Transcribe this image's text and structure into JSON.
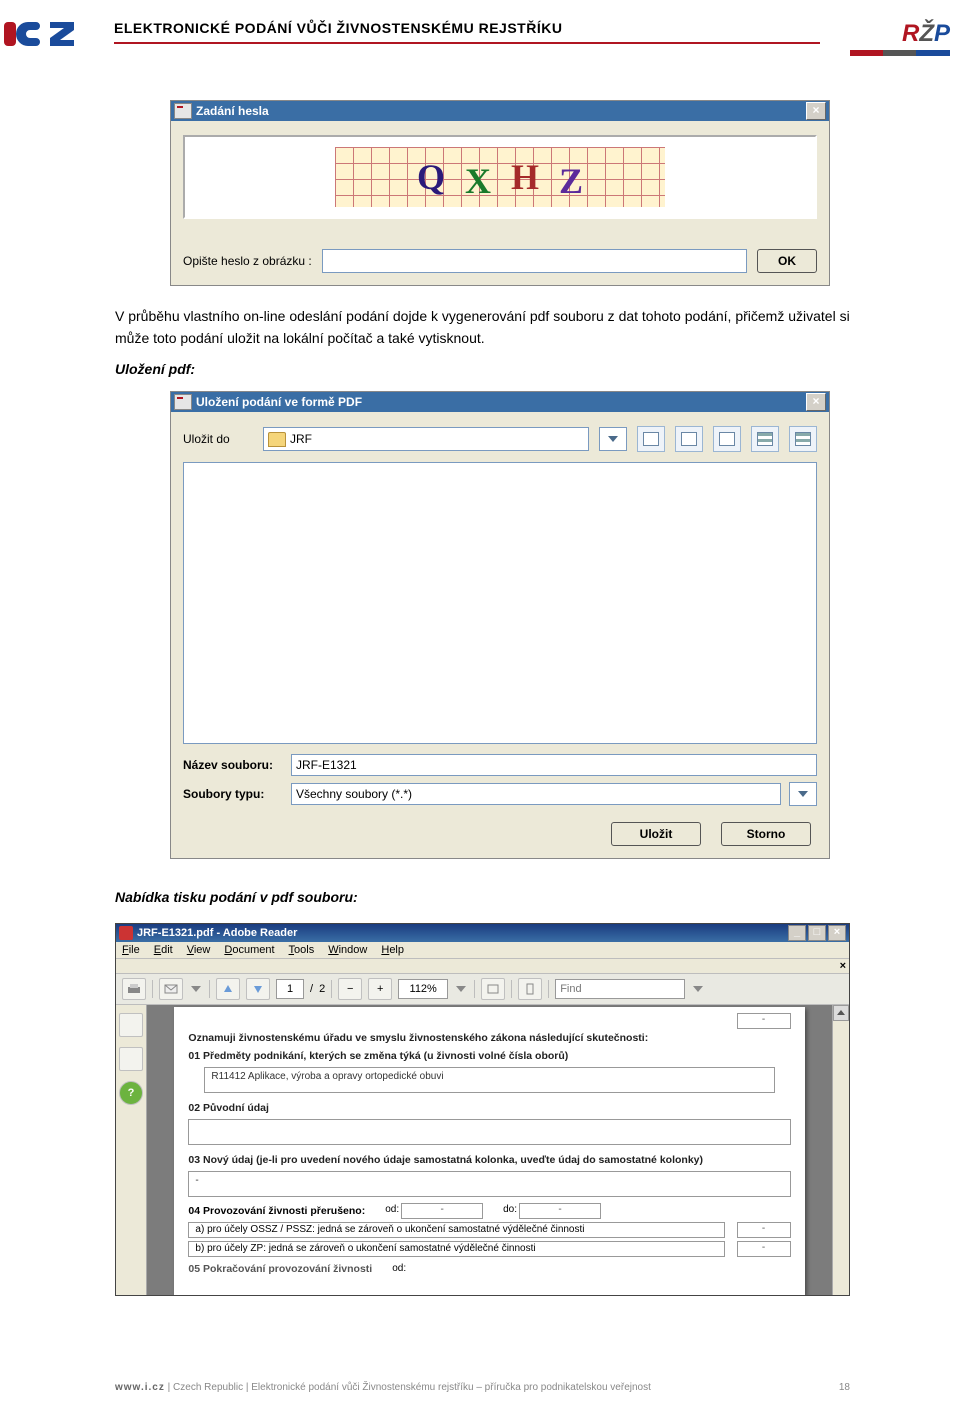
{
  "header": {
    "title": "ELEKTRONICKÉ PODÁNÍ VŮČI ŽIVNOSTENSKÉMU REJSTŘÍKU"
  },
  "captcha_dialog": {
    "title": "Zadání hesla",
    "glyphs": {
      "g1": "Q",
      "g2": "X",
      "g3": "H",
      "g4": "Z"
    },
    "prompt": "Opište heslo z obrázku :",
    "ok_label": "OK",
    "close_glyph": "×"
  },
  "paragraph": {
    "p1": "V průběhu vlastního on-line odeslání podání dojde k vygenerování pdf souboru z dat tohoto podání, přičemž uživatel si může toto podání uložit na lokální počítač a také vytisknout.",
    "h1": "Uložení pdf:"
  },
  "save_dialog": {
    "title": "Uložení podání ve formě PDF",
    "close_glyph": "×",
    "save_to_label": "Uložit do",
    "folder_name": "JRF",
    "filename_label": "Název souboru:",
    "filename_value": "JRF-E1321",
    "filetype_label": "Soubory typu:",
    "filetype_value": "Všechny soubory (*.*)",
    "save_btn": "Uložit",
    "cancel_btn": "Storno"
  },
  "paragraph2": {
    "h1": "Nabídka tisku podání v pdf souboru:"
  },
  "adobe": {
    "title": "JRF-E1321.pdf - Adobe Reader",
    "menu": {
      "file": "File",
      "edit": "Edit",
      "view": "View",
      "document": "Document",
      "tools": "Tools",
      "window": "Window",
      "help": "Help"
    },
    "win": {
      "min": "_",
      "max": "□",
      "close": "×",
      "mdi_close": "×"
    },
    "page_current": "1",
    "page_sep": "/",
    "page_total": "2",
    "zoom": "112%",
    "find_placeholder": "Find",
    "help_glyph": "?",
    "form": {
      "intro": "Oznamuji živnostenskému úřadu ve smyslu živnostenského zákona následující skutečnosti:",
      "s01_label": "01 Předměty podnikání, kterých se změna týká (u živnosti volné čísla oborů)",
      "s01_value": "R11412 Aplikace, výroba a opravy ortopedické obuvi",
      "s02_label": "02 Původní údaj",
      "s03_label": "03 Nový údaj (je-li pro uvedení nového údaje samostatná kolonka, uveďte údaj do samostatné kolonky)",
      "s03_value": "-",
      "s04_label": "04 Provozování živnosti přerušeno:",
      "od": "od:",
      "do": "do:",
      "dash": "-",
      "s04a": "a) pro účely OSSZ / PSSZ: jedná se zároveň o ukončení samostatné výdělečné činnosti",
      "s04b": "b) pro účely ZP: jedná se zároveň o ukončení samostatné výdělečné činnosti",
      "s05_label": "05 Pokračování provozování živnosti"
    }
  },
  "footer": {
    "www": "www.i.cz",
    "sep": " | ",
    "text": "Czech Republic | Elektronické podání vůči Živnostenskému rejstříku – příručka pro podnikatelskou veřejnost",
    "page_num": "18"
  }
}
